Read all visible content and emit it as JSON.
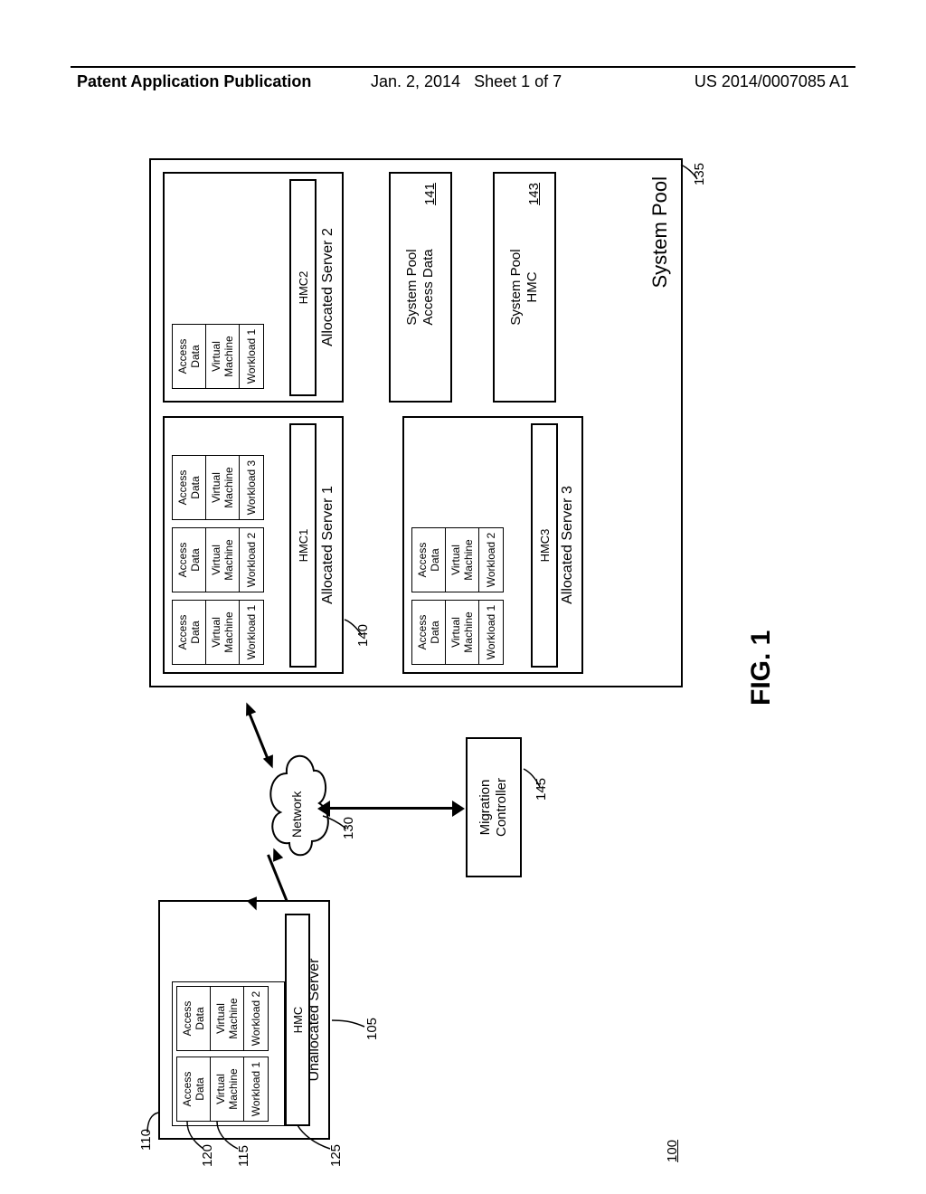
{
  "header": {
    "left": "Patent Application Publication",
    "date": "Jan. 2, 2014",
    "sheet": "Sheet 1 of 7",
    "pubnum": "US 2014/0007085 A1"
  },
  "figure_label": "FIG. 1",
  "refs": {
    "r100": "100",
    "r105": "105",
    "r110": "110",
    "r115": "115",
    "r120": "120",
    "r125": "125",
    "r130": "130",
    "r135": "135",
    "r140": "140",
    "r141": "141",
    "r143": "143",
    "r145": "145"
  },
  "labels": {
    "unallocated_server": "Unallocated Server",
    "allocated_server_1": "Allocated Server 1",
    "allocated_server_2": "Allocated Server 2",
    "allocated_server_3": "Allocated Server 3",
    "system_pool": "System Pool",
    "system_pool_access_data": "System Pool Access Data",
    "system_pool_hmc": "System Pool HMC",
    "migration_controller": "Migration Controller",
    "network": "Network",
    "hmc": "HMC",
    "hmc1": "HMC1",
    "hmc2": "HMC2",
    "hmc3": "HMC3",
    "access_data": "Access Data",
    "virtual_machine": "Virtual Machine",
    "workload_1": "Workload 1",
    "workload_2": "Workload 2",
    "workload_3": "Workload 3"
  }
}
